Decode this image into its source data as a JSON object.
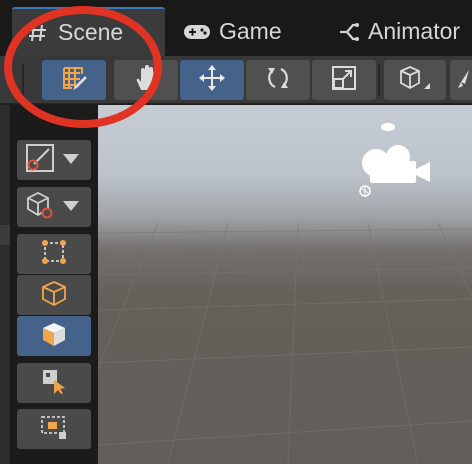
{
  "tabs": [
    {
      "label": "Scene",
      "icon": "hash-icon",
      "active": true
    },
    {
      "label": "Game",
      "icon": "gamepad-icon",
      "active": false
    },
    {
      "label": "Animator",
      "icon": "animator-icon",
      "active": false
    }
  ],
  "toolbar": {
    "tools": [
      {
        "name": "grid-snapping-tool",
        "icon": "grid-pencil-icon",
        "active": true
      },
      {
        "name": "hand-tool",
        "icon": "hand-icon",
        "active": false
      },
      {
        "name": "move-tool",
        "icon": "move-arrows-icon",
        "active": true
      },
      {
        "name": "rotate-tool",
        "icon": "rotate-icon",
        "active": false
      },
      {
        "name": "scale-tool",
        "icon": "scale-icon",
        "active": false
      },
      {
        "name": "draw-mode-dropdown",
        "icon": "cube-wireframe-icon",
        "active": false
      },
      {
        "name": "more-tools",
        "icon": "brush-icon",
        "active": false
      }
    ]
  },
  "overlay_tools": [
    {
      "name": "custom-tool-dropdown",
      "icon": "line-tool-icon",
      "dropdown": true,
      "active": false
    },
    {
      "name": "component-tool-dropdown",
      "icon": "cube-circle-icon",
      "dropdown": true,
      "active": false
    },
    {
      "name": "rect-tool",
      "icon": "rect-transform-icon",
      "dropdown": false,
      "active": false
    },
    {
      "name": "transform-tool",
      "icon": "cube-outline-icon",
      "dropdown": false,
      "active": false
    },
    {
      "name": "transform-all-tool",
      "icon": "cube-filled-icon",
      "dropdown": false,
      "active": true
    },
    {
      "name": "select-tool",
      "icon": "select-cursor-icon",
      "dropdown": false,
      "active": false
    },
    {
      "name": "marquee-tool",
      "icon": "marquee-select-icon",
      "dropdown": false,
      "active": false
    }
  ],
  "scene": {
    "gizmo": "camera-gizmo-icon"
  },
  "annotation": {
    "color": "#e03324",
    "shape": "ellipse"
  },
  "colors": {
    "active_tool": "#45638a",
    "accent_orange": "#f0a54a",
    "tab_accent": "#3a79bb"
  }
}
